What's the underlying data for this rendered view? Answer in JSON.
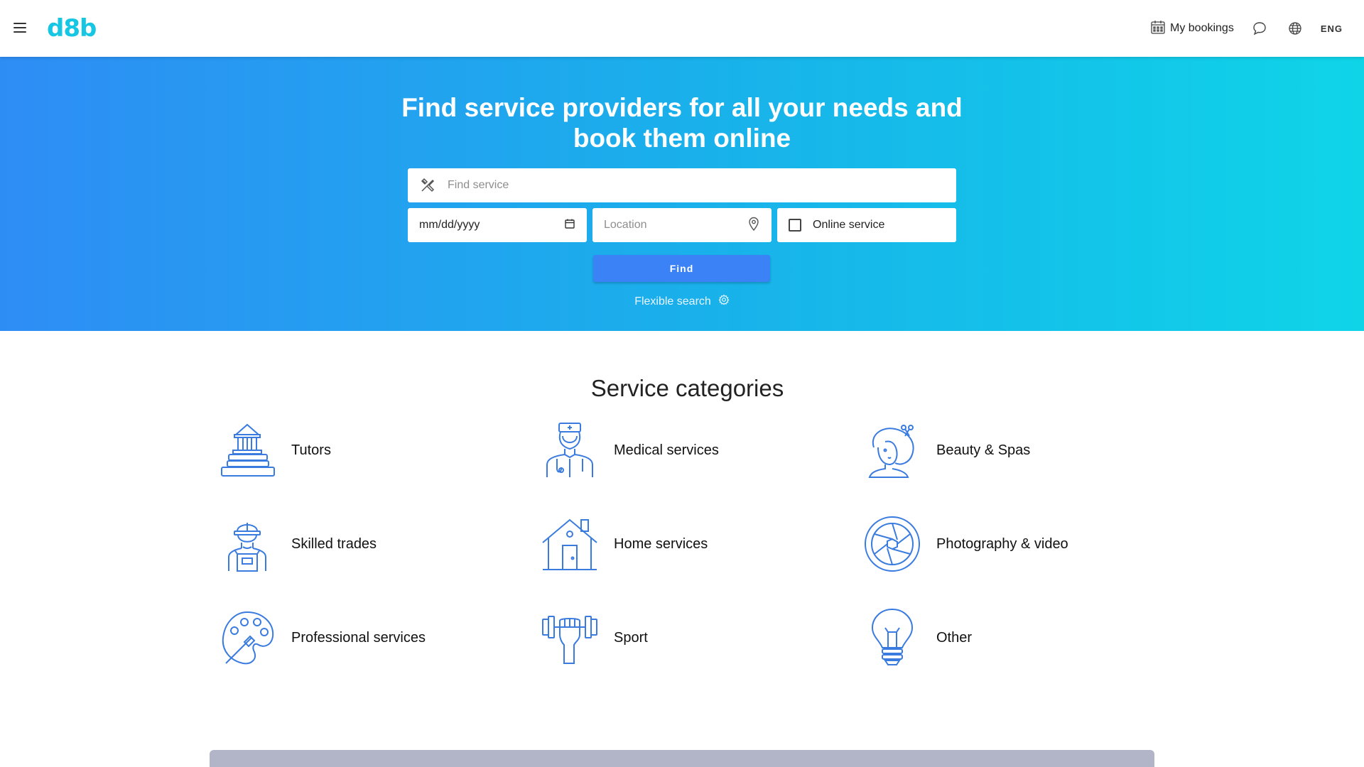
{
  "header": {
    "logo": "d8b",
    "my_bookings": "My bookings",
    "language": "ENG"
  },
  "hero": {
    "title_line1": "Find service providers for all your needs and",
    "title_line2": "book them online",
    "find_service_placeholder": "Find service",
    "date_placeholder": "mm/dd/yyyy",
    "location_placeholder": "Location",
    "online_service_label": "Online service",
    "find_button": "Find",
    "flexible_search": "Flexible search"
  },
  "categories": {
    "title": "Service categories",
    "items": [
      {
        "label": "Tutors",
        "icon": "institution-books-icon"
      },
      {
        "label": "Medical services",
        "icon": "nurse-icon"
      },
      {
        "label": "Beauty & Spas",
        "icon": "hairdresser-icon"
      },
      {
        "label": "Skilled trades",
        "icon": "worker-icon"
      },
      {
        "label": "Home services",
        "icon": "house-icon"
      },
      {
        "label": "Photography & video",
        "icon": "camera-aperture-icon"
      },
      {
        "label": "Professional services",
        "icon": "palette-icon"
      },
      {
        "label": "Sport",
        "icon": "dumbbell-icon"
      },
      {
        "label": "Other",
        "icon": "lightbulb-icon"
      }
    ]
  },
  "colors": {
    "brand": "#16c6e3",
    "hero_gradient_start": "#2e8df5",
    "hero_gradient_end": "#0fd4e8",
    "button": "#3b82f6",
    "icon_stroke": "#3a7be0"
  }
}
